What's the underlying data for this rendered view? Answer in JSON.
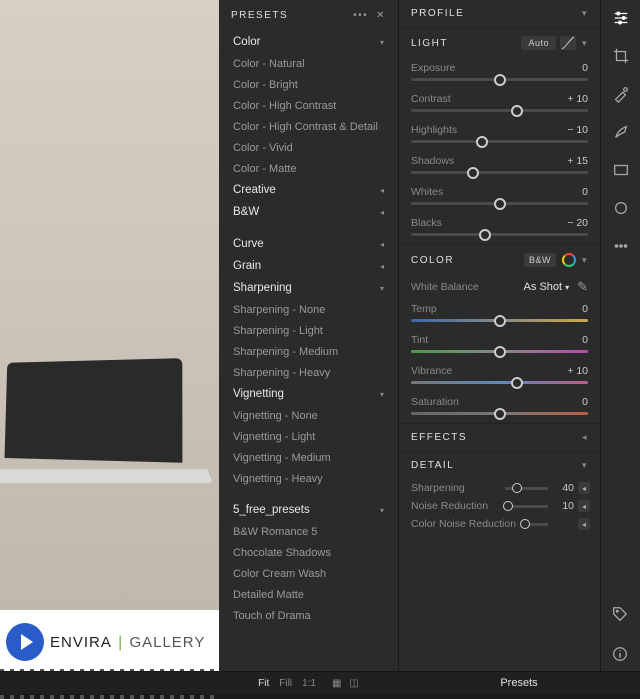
{
  "presets": {
    "header": "PRESETS",
    "groups": [
      {
        "label": "Color",
        "expanded": true,
        "items": [
          "Color - Natural",
          "Color - Bright",
          "Color - High Contrast",
          "Color - High Contrast & Detail",
          "Color - Vivid",
          "Color - Matte"
        ]
      },
      {
        "label": "Creative",
        "expanded": false,
        "items": []
      },
      {
        "label": "B&W",
        "expanded": false,
        "items": []
      },
      {
        "label": "Curve",
        "expanded": false,
        "items": []
      },
      {
        "label": "Grain",
        "expanded": false,
        "items": []
      },
      {
        "label": "Sharpening",
        "expanded": true,
        "items": [
          "Sharpening - None",
          "Sharpening - Light",
          "Sharpening - Medium",
          "Sharpening - Heavy"
        ]
      },
      {
        "label": "Vignetting",
        "expanded": true,
        "items": [
          "Vignetting - None",
          "Vignetting - Light",
          "Vignetting - Medium",
          "Vignetting - Heavy"
        ]
      },
      {
        "label": "5_free_presets",
        "expanded": true,
        "items": [
          "B&W Romance 5",
          "Chocolate Shadows",
          "Color Cream Wash",
          "Detailed Matte",
          "Touch of Drama"
        ]
      }
    ]
  },
  "profile": {
    "header": "PROFILE"
  },
  "light": {
    "header": "LIGHT",
    "auto": "Auto",
    "sliders": [
      {
        "name": "Exposure",
        "value": "0",
        "pos": 50
      },
      {
        "name": "Contrast",
        "value": "+ 10",
        "pos": 60
      },
      {
        "name": "Highlights",
        "value": "− 10",
        "pos": 40
      },
      {
        "name": "Shadows",
        "value": "+ 15",
        "pos": 35
      },
      {
        "name": "Whites",
        "value": "0",
        "pos": 50
      },
      {
        "name": "Blacks",
        "value": "− 20",
        "pos": 42
      }
    ]
  },
  "color": {
    "header": "COLOR",
    "bw": "B&W",
    "wb_label": "White Balance",
    "wb_value": "As Shot",
    "sliders": [
      {
        "name": "Temp",
        "value": "0",
        "pos": 50,
        "grad": "temp"
      },
      {
        "name": "Tint",
        "value": "0",
        "pos": 50,
        "grad": "tint"
      },
      {
        "name": "Vibrance",
        "value": "+ 10",
        "pos": 60,
        "grad": "vib"
      },
      {
        "name": "Saturation",
        "value": "0",
        "pos": 50,
        "grad": "sat"
      }
    ]
  },
  "effects": {
    "header": "EFFECTS"
  },
  "detail": {
    "header": "DETAIL",
    "rows": [
      {
        "name": "Sharpening",
        "value": "40",
        "pos": 28
      },
      {
        "name": "Noise Reduction",
        "value": "10",
        "pos": 8
      },
      {
        "name": "Color Noise Reduction",
        "value": "",
        "pos": 4
      }
    ]
  },
  "bottom": {
    "zoom": [
      "Fit",
      "Fill",
      "1:1"
    ],
    "presets_label": "Presets"
  },
  "logo": {
    "brand1": "ENVIRA",
    "brand2": "GALLERY"
  }
}
